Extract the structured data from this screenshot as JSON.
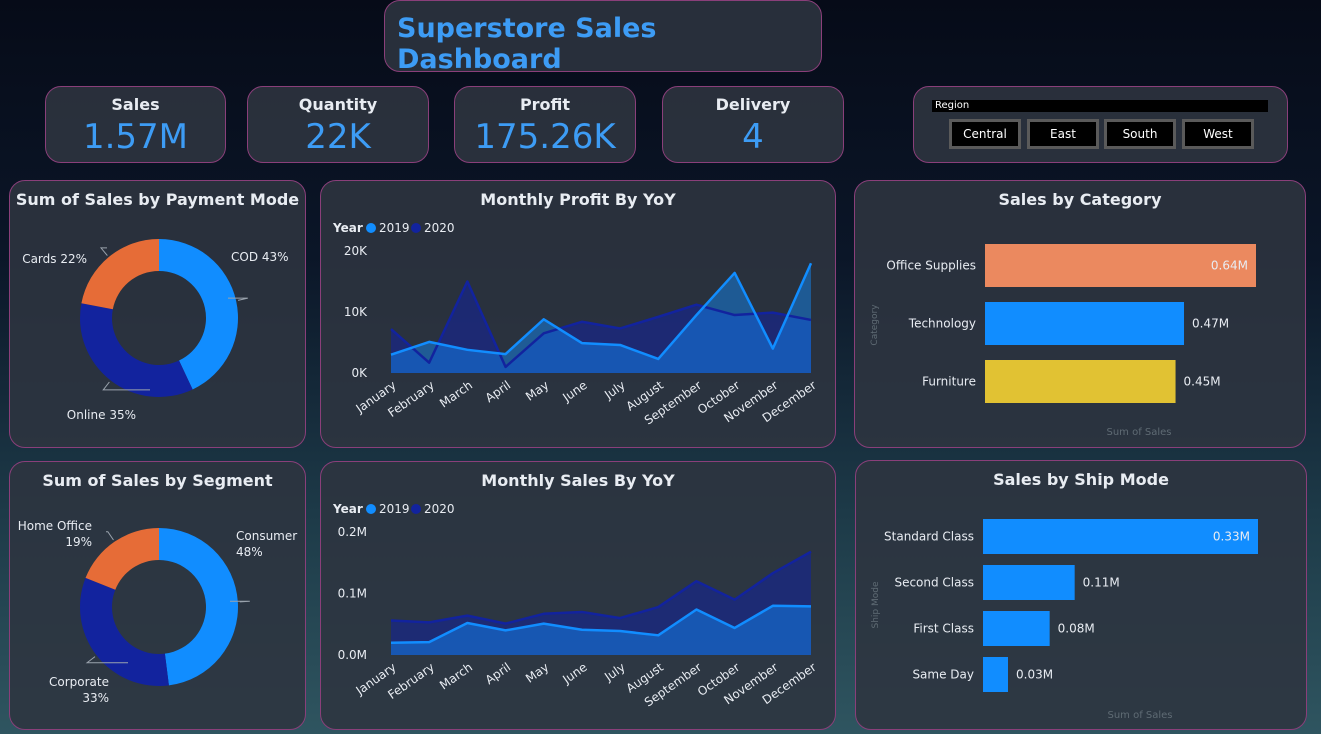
{
  "header": {
    "title": "Superstore Sales Dashboard"
  },
  "kpis": [
    {
      "label": "Sales",
      "value": "1.57M"
    },
    {
      "label": "Quantity",
      "value": "22K"
    },
    {
      "label": "Profit",
      "value": "175.26K"
    },
    {
      "label": "Delivery",
      "value": "4"
    }
  ],
  "region_slicer": {
    "label": "Region",
    "options": [
      "Central",
      "East",
      "South",
      "West"
    ]
  },
  "colors": {
    "accent": "#3d9cf5",
    "light_blue": "#118dff",
    "dark_blue": "#12239e",
    "orange": "#e66c37",
    "salmon": "#eb895f",
    "yellow": "#e1c233",
    "border": "#8a3f7a"
  },
  "panels": {
    "payment_mode": {
      "title": "Sum of Sales by Payment Mode"
    },
    "profit_yoy": {
      "title": "Monthly Profit By YoY"
    },
    "category": {
      "title": "Sales by Category"
    },
    "segment": {
      "title": "Sum of Sales by Segment"
    },
    "sales_yoy": {
      "title": "Monthly Sales By YoY"
    },
    "ship_mode": {
      "title": "Sales by Ship Mode"
    }
  },
  "chart_data": [
    {
      "id": "payment_mode",
      "type": "pie",
      "donut": true,
      "title": "Sum of Sales by Payment Mode",
      "slices": [
        {
          "name": "COD",
          "label": "COD 43%",
          "value": 43,
          "color": "#118dff"
        },
        {
          "name": "Online",
          "label": "Online 35%",
          "value": 35,
          "color": "#12239e"
        },
        {
          "name": "Cards",
          "label": "Cards 22%",
          "value": 22,
          "color": "#e66c37"
        }
      ]
    },
    {
      "id": "profit_yoy",
      "type": "area",
      "title": "Monthly Profit By YoY",
      "legend_title": "Year",
      "categories": [
        "January",
        "February",
        "March",
        "April",
        "May",
        "June",
        "July",
        "August",
        "September",
        "October",
        "November",
        "December"
      ],
      "yticks": [
        {
          "v": 0,
          "t": "0K"
        },
        {
          "v": 10000,
          "t": "10K"
        },
        {
          "v": 20000,
          "t": "20K"
        }
      ],
      "ylim": [
        0,
        20000
      ],
      "series": [
        {
          "name": "2019",
          "color": "#118dff",
          "values": [
            3000,
            5100,
            3800,
            3100,
            8800,
            4900,
            4600,
            2300,
            9500,
            16400,
            4000,
            18000
          ]
        },
        {
          "name": "2020",
          "color": "#12239e",
          "values": [
            7200,
            1700,
            15000,
            1000,
            6500,
            8400,
            7300,
            9200,
            11200,
            9500,
            9900,
            8700
          ]
        }
      ]
    },
    {
      "id": "category",
      "type": "bar",
      "orientation": "horizontal",
      "title": "Sales by Category",
      "xlabel": "Sum of Sales",
      "ylabel": "Category",
      "categories": [
        "Office Supplies",
        "Technology",
        "Furniture"
      ],
      "values": [
        0.64,
        0.47,
        0.45
      ],
      "value_labels": [
        "0.64M",
        "0.47M",
        "0.45M"
      ],
      "colors": [
        "#eb895f",
        "#118dff",
        "#e1c233"
      ]
    },
    {
      "id": "segment",
      "type": "pie",
      "donut": true,
      "title": "Sum of Sales by Segment",
      "slices": [
        {
          "name": "Consumer",
          "label": "Consumer 48%",
          "value": 48,
          "color": "#118dff"
        },
        {
          "name": "Corporate",
          "label": "Corporate 33%",
          "value": 33,
          "color": "#12239e"
        },
        {
          "name": "Home Office",
          "label": "Home Office 19%",
          "value": 19,
          "color": "#e66c37"
        }
      ]
    },
    {
      "id": "sales_yoy",
      "type": "area",
      "title": "Monthly Sales By YoY",
      "legend_title": "Year",
      "categories": [
        "January",
        "February",
        "March",
        "April",
        "May",
        "June",
        "July",
        "August",
        "September",
        "October",
        "November",
        "December"
      ],
      "yticks": [
        {
          "v": 0,
          "t": "0.0M"
        },
        {
          "v": 0.1,
          "t": "0.1M"
        },
        {
          "v": 0.2,
          "t": "0.2M"
        }
      ],
      "ylim": [
        0,
        0.2
      ],
      "series": [
        {
          "name": "2019",
          "color": "#118dff",
          "values": [
            0.02,
            0.021,
            0.052,
            0.04,
            0.051,
            0.041,
            0.039,
            0.032,
            0.074,
            0.044,
            0.08,
            0.079
          ]
        },
        {
          "name": "2020",
          "color": "#12239e",
          "values": [
            0.056,
            0.053,
            0.064,
            0.051,
            0.067,
            0.07,
            0.06,
            0.078,
            0.12,
            0.09,
            0.133,
            0.168
          ]
        }
      ]
    },
    {
      "id": "ship_mode",
      "type": "bar",
      "orientation": "horizontal",
      "title": "Sales by Ship Mode",
      "xlabel": "Sum of Sales",
      "ylabel": "Ship Mode",
      "categories": [
        "Standard Class",
        "Second Class",
        "First Class",
        "Same Day"
      ],
      "values": [
        0.33,
        0.11,
        0.08,
        0.03
      ],
      "value_labels": [
        "0.33M",
        "0.11M",
        "0.08M",
        "0.03M"
      ],
      "colors": [
        "#118dff",
        "#118dff",
        "#118dff",
        "#118dff"
      ]
    }
  ]
}
